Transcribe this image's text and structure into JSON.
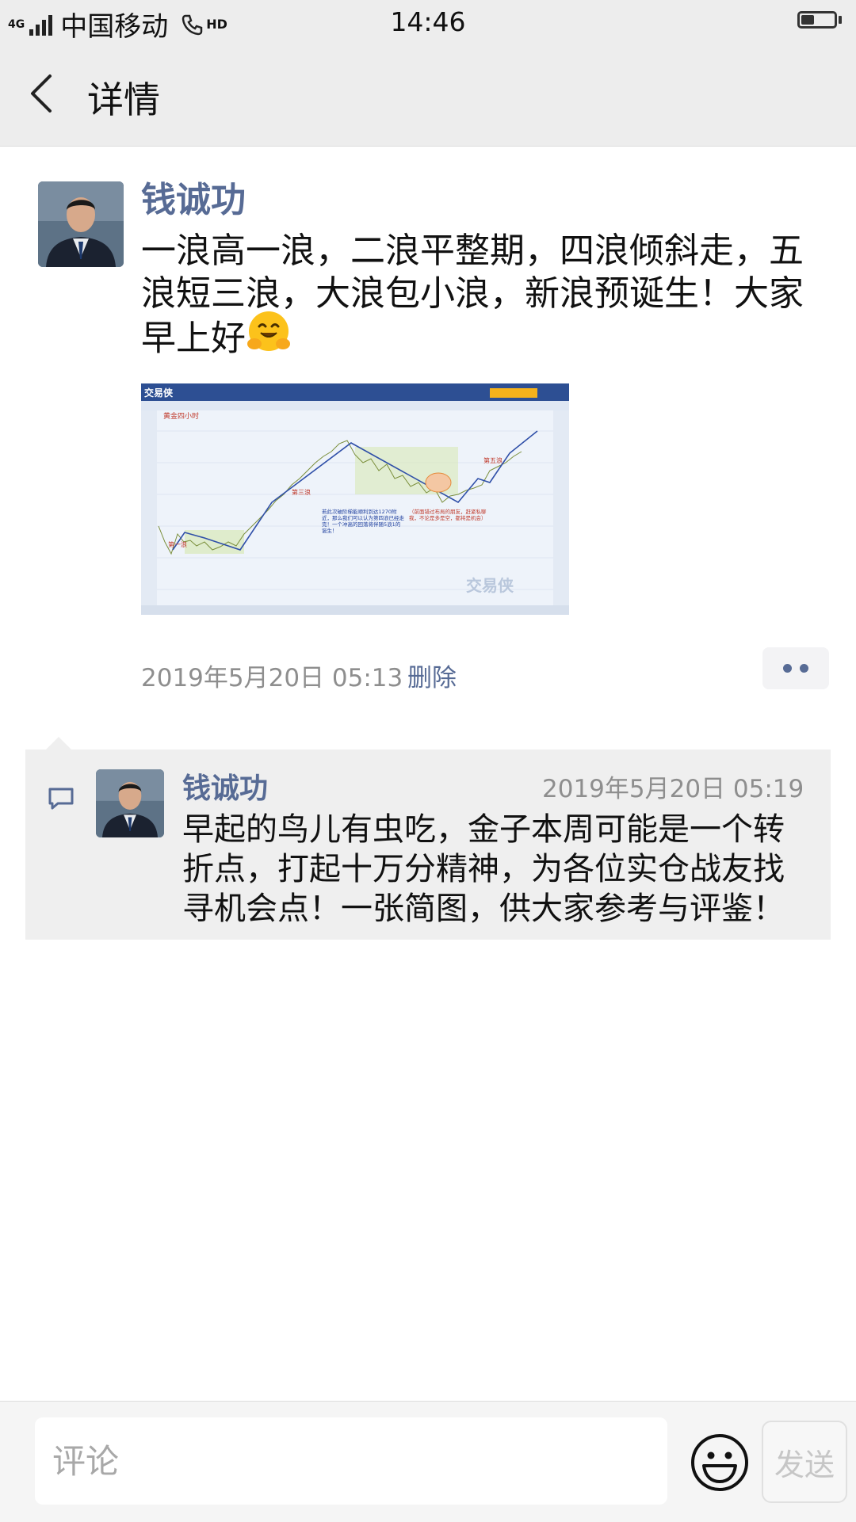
{
  "status_bar": {
    "network": "4G",
    "carrier": "中国移动",
    "hd_label": "HD",
    "time": "14:46",
    "battery_level": 0.4
  },
  "header": {
    "back_icon": "chevron-left-icon",
    "title": "详情"
  },
  "post": {
    "author": "钱诚功",
    "text": "一浪高一浪，二浪平整期，四浪倾斜走，五浪短三浪，大浪包小浪，新浪预诞生！大家早上好",
    "emoji": "hugging-face-emoji",
    "image": {
      "brand": "交易侠",
      "chart_title": "黄金四小时",
      "labels": {
        "wave1": "第一浪",
        "wave3": "第三浪",
        "wave5": "第五浪",
        "note_left": "若此次破阶梯能顺利到达1270附近，那么我们可以认为第四浪已经走完！一个冲高的回落将伴随5浪1的诞生！",
        "note_right": "（前面错过布局的朋友，赶紧私聊我，不论是多是空，都将是机会）"
      }
    },
    "time": "2019年5月20日 05:13",
    "delete_label": "删除"
  },
  "comments": [
    {
      "author": "钱诚功",
      "time": "2019年5月20日 05:19",
      "text": "早起的鸟儿有虫吃，金子本周可能是一个转折点，打起十万分精神，为各位实仓战友找寻机会点！一张简图，供大家参考与评鉴！"
    }
  ],
  "comment_bar": {
    "placeholder": "评论",
    "send_label": "发送"
  },
  "colors": {
    "link": "#576b95",
    "header_bg": "#ededed",
    "comment_bg": "#efefef"
  }
}
